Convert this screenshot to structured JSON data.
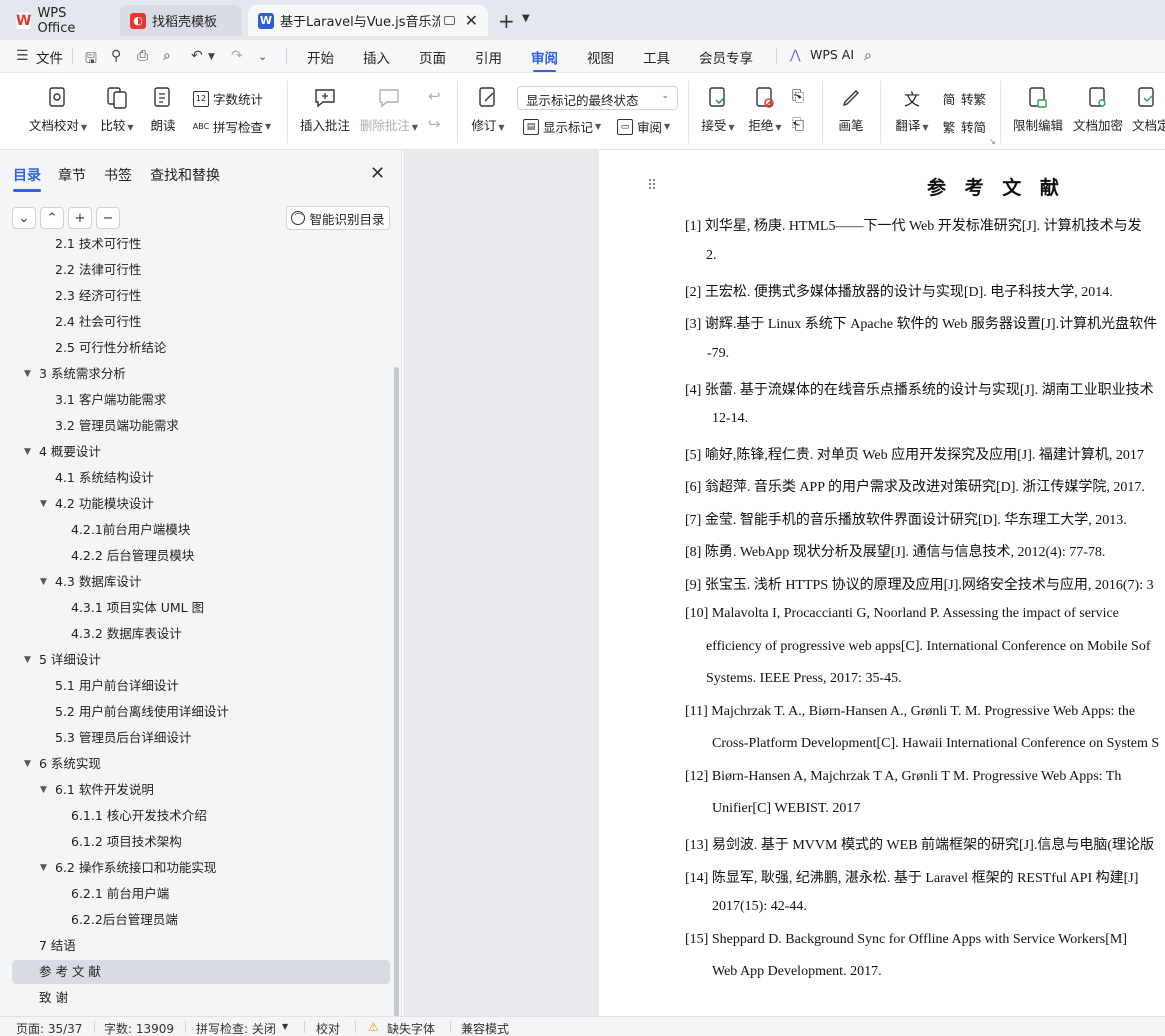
{
  "tabs": [
    {
      "label": "WPS Office"
    },
    {
      "label": "找稻壳模板"
    },
    {
      "label": "基于Laravel与Vue.js音乐流媒体"
    }
  ],
  "menu": {
    "file": "文件",
    "items": [
      "开始",
      "插入",
      "页面",
      "引用",
      "审阅",
      "视图",
      "工具",
      "会员专享"
    ],
    "active": "审阅",
    "ai": "WPS AI"
  },
  "ribbon": {
    "doc_proofread": "文档校对",
    "compare": "比较",
    "read_aloud": "朗读",
    "word_count": "字数统计",
    "spell_check": "拼写检查",
    "insert_comment": "插入批注",
    "delete_comment": "删除批注",
    "revise": "修订",
    "markup_state": "显示标记的最终状态",
    "show_markup": "显示标记",
    "review": "审阅",
    "accept": "接受",
    "reject": "拒绝",
    "pen": "画笔",
    "translate": "翻译",
    "to_traditional": "转繁",
    "to_simplified": "转简",
    "restrict_edit": "限制编辑",
    "doc_encrypt": "文档加密",
    "doc_more": "文档定"
  },
  "panel": {
    "tabs": [
      "目录",
      "章节",
      "书签",
      "查找和替换"
    ],
    "smart_toc": "智能识别目录",
    "toc": [
      {
        "label": "2.1  技术可行性",
        "level": 2
      },
      {
        "label": "2.2    法律可行性",
        "level": 2
      },
      {
        "label": "2.3    经济可行性",
        "level": 2
      },
      {
        "label": "2.4    社会可行性",
        "level": 2
      },
      {
        "label": "2.5    可行性分析结论",
        "level": 2
      },
      {
        "label": "3    系统需求分析",
        "level": 1,
        "expanded": true
      },
      {
        "label": "3.1    客户端功能需求",
        "level": 2
      },
      {
        "label": "3.2    管理员端功能需求",
        "level": 2
      },
      {
        "label": "4    概要设计",
        "level": 1,
        "expanded": true
      },
      {
        "label": "4.1    系统结构设计",
        "level": 2
      },
      {
        "label": "4.2    功能模块设计",
        "level": 2,
        "expanded": true
      },
      {
        "label": "4.2.1前台用户端模块",
        "level": 3
      },
      {
        "label": "4.2.2    后台管理员模块",
        "level": 3
      },
      {
        "label": "4.3    数据库设计",
        "level": 2,
        "expanded": true
      },
      {
        "label": "4.3.1    项目实体 UML 图",
        "level": 3
      },
      {
        "label": "4.3.2    数据库表设计",
        "level": 3
      },
      {
        "label": "5    详细设计",
        "level": 1,
        "expanded": true
      },
      {
        "label": "5.1    用户前台详细设计",
        "level": 2
      },
      {
        "label": "5.2    用户前台离线使用详细设计",
        "level": 2
      },
      {
        "label": "5.3    管理员后台详细设计",
        "level": 2
      },
      {
        "label": "6    系统实现",
        "level": 1,
        "expanded": true
      },
      {
        "label": "6.1    软件开发说明",
        "level": 2,
        "expanded": true
      },
      {
        "label": "6.1.1    核心开发技术介绍",
        "level": 3
      },
      {
        "label": "6.1.2    项目技术架构",
        "level": 3
      },
      {
        "label": "6.2    操作系统接口和功能实现",
        "level": 2,
        "expanded": true
      },
      {
        "label": "6.2.1    前台用户端",
        "level": 3
      },
      {
        "label": "6.2.2后台管理员端",
        "level": 3
      },
      {
        "label": "7    结语",
        "level": 1
      },
      {
        "label": "参  考  文  献",
        "level": 1,
        "selected": true
      },
      {
        "label": "致          谢",
        "level": 1
      }
    ]
  },
  "document": {
    "title": "参 考 文 献",
    "lines": [
      "[1]  刘华星, 杨庚. HTML5——下一代 Web 开发标准研究[J]. 计算机技术与发",
      "2.",
      "[2]  王宏松. 便携式多媒体播放器的设计与实现[D]. 电子科技大学, 2014.",
      "[3]  谢辉.基于 Linux 系统下 Apache 软件的 Web 服务器设置[J].计算机光盘软件",
      "-79.",
      "[4]  张蕾. 基于流媒体的在线音乐点播系统的设计与实现[J]. 湖南工业职业技术",
      "12-14.",
      "[5]  喻好,陈锋,程仁贵. 对单页 Web 应用开发探究及应用[J]. 福建计算机, 2017",
      "[6]  翁超萍. 音乐类 APP 的用户需求及改进对策研究[D]. 浙江传媒学院, 2017.",
      "[7]  金莹. 智能手机的音乐播放软件界面设计研究[D]. 华东理工大学, 2013.",
      "[8]  陈勇. WebApp 现状分析及展望[J]. 通信与信息技术, 2012(4): 77-78.",
      "[9]  张宝玉. 浅析 HTTPS 协议的原理及应用[J].网络安全技术与应用, 2016(7): 3",
      "[10]  Malavolta I, Procaccianti G, Noorland P. Assessing the impact of service",
      "efficiency of progressive web apps[C]. International Conference on Mobile Sof",
      "Systems. IEEE Press, 2017: 35-45.",
      "[11]  Majchrzak T. A., Biørn-Hansen A., Grønli T. M. Progressive Web Apps: the",
      "Cross-Platform Development[C]. Hawaii International Conference on System S",
      "[12]  Biørn-Hansen A, Majchrzak T A, Grønli T M. Progressive Web Apps: Th",
      "Unifier[C] WEBIST. 2017",
      "[13]  易剑波. 基于 MVVM 模式的 WEB 前端框架的研究[J].信息与电脑(理论版",
      "[14]  陈显军, 耿强, 纪沸鹏, 湛永松. 基于 Laravel 框架的 RESTful API 构建[J]",
      "2017(15): 42-44.",
      "[15]  Sheppard D. Background Sync for Offline Apps with Service Workers[M]",
      "Web App Development. 2017."
    ]
  },
  "status": {
    "page": "页面: 35/37",
    "words": "字数: 13909",
    "spell": "拼写检查: 关闭",
    "proof": "校对",
    "missing_font": "缺失字体",
    "compat": "兼容模式"
  },
  "colors": {
    "accent": "#2f63e4",
    "wps_red": "#e5372b",
    "doc_blue": "#2b5fd9"
  }
}
